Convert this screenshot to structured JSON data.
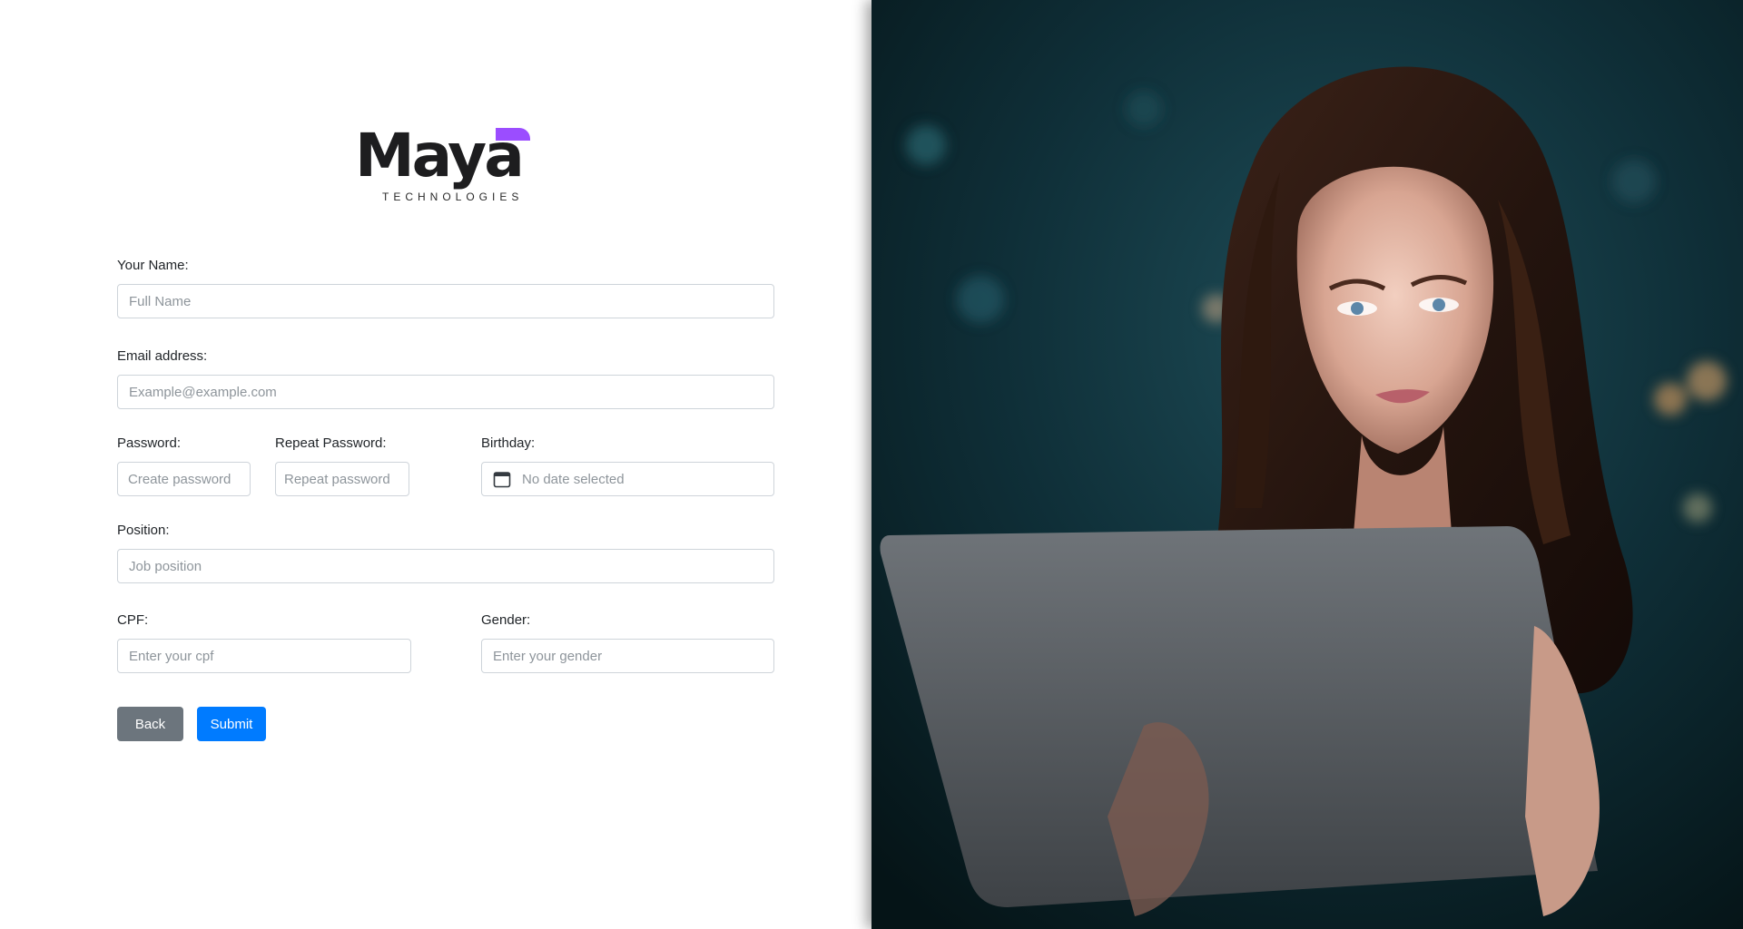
{
  "logo": {
    "name": "Maya",
    "tagline": "TECHNOLOGIES",
    "accent_color": "#9b4dff"
  },
  "form": {
    "name": {
      "label": "Your Name:",
      "placeholder": "Full Name",
      "value": ""
    },
    "email": {
      "label": "Email address:",
      "placeholder": "Example@example.com",
      "value": ""
    },
    "password": {
      "label": "Password:",
      "placeholder": "Create password",
      "value": ""
    },
    "repeat_password": {
      "label": "Repeat Password:",
      "placeholder": "Repeat password",
      "value": ""
    },
    "birthday": {
      "label": "Birthday:",
      "value": "No date selected",
      "icon": "calendar-icon"
    },
    "position": {
      "label": "Position:",
      "placeholder": "Job position",
      "value": ""
    },
    "cpf": {
      "label": "CPF:",
      "placeholder": "Enter your cpf",
      "value": ""
    },
    "gender": {
      "label": "Gender:",
      "placeholder": "Enter your gender",
      "value": ""
    }
  },
  "buttons": {
    "back_label": "Back",
    "back_color": "#6c757d",
    "submit_label": "Submit",
    "submit_color": "#007bff"
  },
  "hero_image": {
    "subject": "woman-using-tablet-photo"
  }
}
